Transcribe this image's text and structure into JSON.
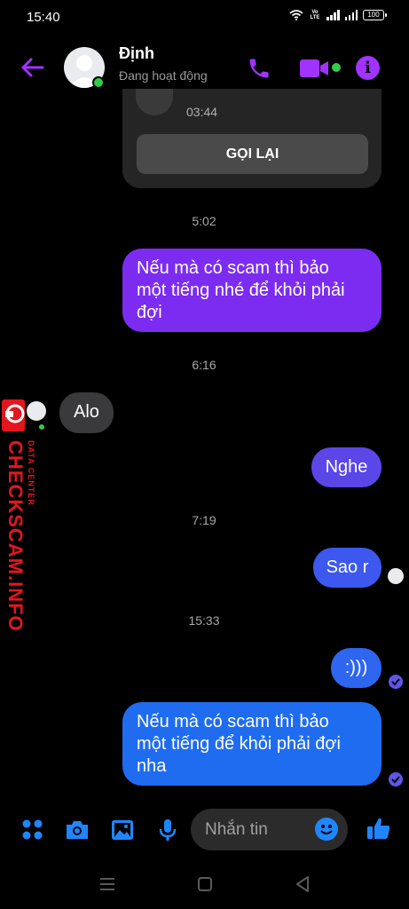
{
  "status_bar": {
    "time": "15:40",
    "network": "Vo LTE",
    "battery": "100"
  },
  "header": {
    "contact_name": "Định",
    "contact_status": "Đang hoạt động"
  },
  "call_card": {
    "duration": "03:44",
    "callback_label": "GỌI LẠI"
  },
  "messages": [
    {
      "type": "timestamp",
      "text": "5:02"
    },
    {
      "type": "sent",
      "text": "Nếu mà có scam thì bảo\nmột tiếng nhé để khỏi phải\nđợi"
    },
    {
      "type": "timestamp",
      "text": "6:16"
    },
    {
      "type": "received",
      "text": "Alo"
    },
    {
      "type": "sent",
      "text": "Nghe"
    },
    {
      "type": "timestamp",
      "text": "7:19"
    },
    {
      "type": "sent",
      "text": "Sao r"
    },
    {
      "type": "timestamp",
      "text": "15:33"
    },
    {
      "type": "sent",
      "text": ":)))"
    },
    {
      "type": "sent",
      "text": "Nếu mà có scam thì bảo\nmột tiếng để khỏi phải đợi\nnha"
    }
  ],
  "composer": {
    "placeholder": "Nhắn tin"
  },
  "watermark": {
    "main": "CHECKSCAM.INFO",
    "sub": "DATA CENTER"
  },
  "colors": {
    "accent": "#a033ff",
    "online": "#31cc46",
    "bubble_purple": "#7c2cf0",
    "bubble_blue": "#1f6cf0",
    "icon_blue": "#1f86ff"
  }
}
